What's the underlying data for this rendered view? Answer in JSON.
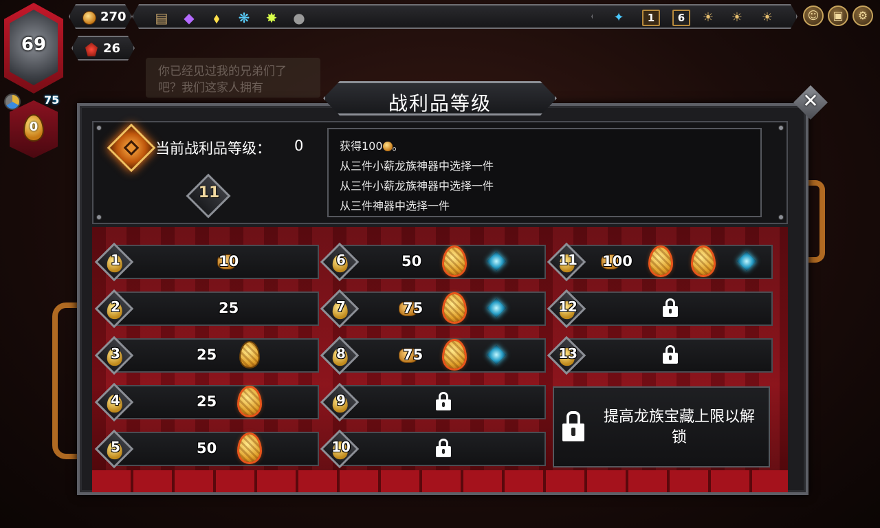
{
  "hud": {
    "coins": "270",
    "gems": "26",
    "player_level": "69",
    "shard_count": "75",
    "egg_count": "0",
    "background_speech": "你已经见过我的兄弟们了吧？我们这家人拥有",
    "artifact_icons": [
      "map-scroll-icon",
      "purple-crystal-icon",
      "yellow-gem-icon",
      "blue-rune-icon",
      "lightning-icon",
      "stone-tablet-icon"
    ],
    "right_icons": {
      "book_count": "1",
      "scroll_count": "6"
    }
  },
  "dialog": {
    "title": "战利品等级",
    "current_level_label": "当前战利品等级：",
    "current_level_value": "0",
    "next_level_badge": "11",
    "rewards": [
      "获得100",
      "。",
      "从三件小薪龙族神器中选择一件",
      "从三件小薪龙族神器中选择一件",
      "从三件神器中选择一件"
    ],
    "unlock_message": "提高龙族宝藏上限以解锁"
  },
  "tiers": {
    "t1": {
      "num": "1",
      "coins": "10"
    },
    "t2": {
      "num": "2",
      "coins": "25"
    },
    "t3": {
      "num": "3",
      "coins": "25"
    },
    "t4": {
      "num": "4",
      "coins": "25"
    },
    "t5": {
      "num": "5",
      "coins": "50"
    },
    "t6": {
      "num": "6",
      "coins": "50"
    },
    "t7": {
      "num": "7",
      "coins": "75"
    },
    "t8": {
      "num": "8",
      "coins": "75"
    },
    "t9": {
      "num": "9"
    },
    "t10": {
      "num": "10"
    },
    "t11": {
      "num": "11",
      "coins": "100"
    },
    "t12": {
      "num": "12"
    },
    "t13": {
      "num": "13"
    }
  },
  "colors": {
    "accent_orange": "#e8551a",
    "curtain_red": "#8a1018",
    "frame_gray": "#5d5f66",
    "pipe_copper": "#b06a22"
  }
}
